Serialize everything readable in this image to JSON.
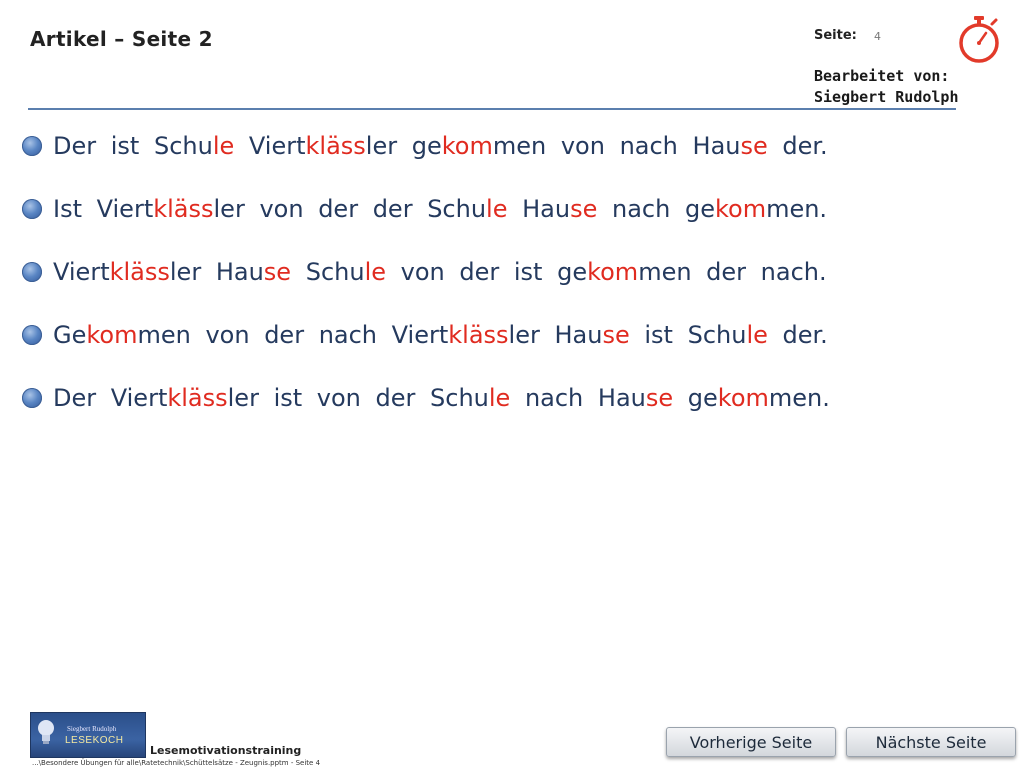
{
  "header": {
    "title": "Artikel – Seite 2",
    "page_label": "Seite:",
    "page_number": "4",
    "edited_by_label": "Bearbeitet von:",
    "edited_by_name": "Siegbert Rudolph"
  },
  "icons": {
    "stopwatch": "stopwatch-icon",
    "bullet": "bullet-circle-icon"
  },
  "colors": {
    "highlight": "#e02b20",
    "text": "#253a5e",
    "divider": "#5b7fae"
  },
  "sentences": [
    [
      {
        "t": "Der "
      },
      {
        "t": "ist "
      },
      {
        "t": "Schu"
      },
      {
        "t": "le",
        "hl": true
      },
      {
        "t": " "
      },
      {
        "t": "Viert"
      },
      {
        "t": "kläss",
        "hl": true
      },
      {
        "t": "ler "
      },
      {
        "t": "ge"
      },
      {
        "t": "kom",
        "hl": true
      },
      {
        "t": "men "
      },
      {
        "t": "von "
      },
      {
        "t": "nach "
      },
      {
        "t": "Hau"
      },
      {
        "t": "se",
        "hl": true
      },
      {
        "t": " der."
      }
    ],
    [
      {
        "t": "Ist "
      },
      {
        "t": "Viert"
      },
      {
        "t": "kläss",
        "hl": true
      },
      {
        "t": "ler "
      },
      {
        "t": "von "
      },
      {
        "t": "der "
      },
      {
        "t": "der "
      },
      {
        "t": "Schu"
      },
      {
        "t": "le",
        "hl": true
      },
      {
        "t": " "
      },
      {
        "t": "Hau"
      },
      {
        "t": "se",
        "hl": true
      },
      {
        "t": " nach "
      },
      {
        "t": "ge"
      },
      {
        "t": "kom",
        "hl": true
      },
      {
        "t": "men."
      }
    ],
    [
      {
        "t": "Viert"
      },
      {
        "t": "kläss",
        "hl": true
      },
      {
        "t": "ler "
      },
      {
        "t": "Hau"
      },
      {
        "t": "se",
        "hl": true
      },
      {
        "t": " "
      },
      {
        "t": "Schu"
      },
      {
        "t": "le",
        "hl": true
      },
      {
        "t": " von der ist "
      },
      {
        "t": "ge"
      },
      {
        "t": "kom",
        "hl": true
      },
      {
        "t": "men der nach."
      }
    ],
    [
      {
        "t": "Ge"
      },
      {
        "t": "kom",
        "hl": true
      },
      {
        "t": "men von der nach "
      },
      {
        "t": "Viert"
      },
      {
        "t": "kläss",
        "hl": true
      },
      {
        "t": "ler "
      },
      {
        "t": "Hau"
      },
      {
        "t": "se",
        "hl": true
      },
      {
        "t": " ist "
      },
      {
        "t": "Schu"
      },
      {
        "t": "le",
        "hl": true
      },
      {
        "t": " der."
      }
    ],
    [
      {
        "t": "Der "
      },
      {
        "t": "Viert"
      },
      {
        "t": "kläss",
        "hl": true
      },
      {
        "t": "ler "
      },
      {
        "t": "ist von der "
      },
      {
        "t": "Schu"
      },
      {
        "t": "le",
        "hl": true
      },
      {
        "t": " nach "
      },
      {
        "t": "Hau"
      },
      {
        "t": "se",
        "hl": true
      },
      {
        "t": " "
      },
      {
        "t": "ge"
      },
      {
        "t": "kom",
        "hl": true
      },
      {
        "t": "men."
      }
    ]
  ],
  "logo": {
    "name": "Siegbert Rudolph",
    "word": "LESEKOCH"
  },
  "footer": {
    "label": "Lesemotivationstraining",
    "path": "...\\Besondere Übungen für alle\\Ratetechnik\\Schüttelsätze - Zeugnis.pptm - Seite 4"
  },
  "nav": {
    "prev_label": "Vorherige Seite",
    "next_label": "Nächste Seite"
  }
}
